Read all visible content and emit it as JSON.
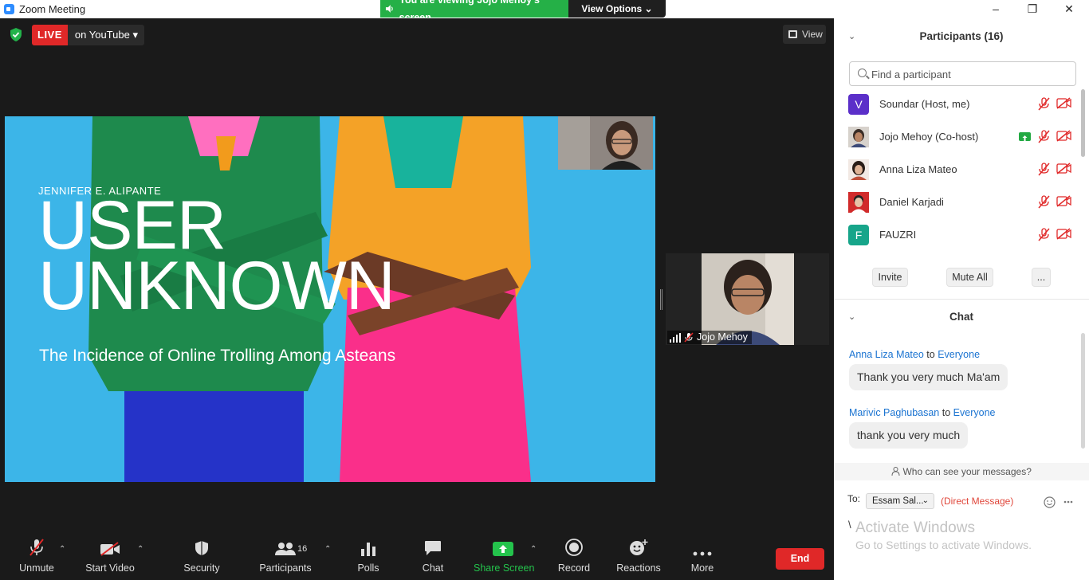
{
  "window": {
    "title": "Zoom Meeting",
    "minimize": "–",
    "restore": "❐",
    "close": "✕"
  },
  "banner": {
    "viewing_text": "You are viewing Jojo Mehoy's screen",
    "view_options": "View Options ⌄"
  },
  "live": {
    "badge": "LIVE",
    "destination": "on YouTube ▾"
  },
  "view_button": "View",
  "slide": {
    "author": "JENNIFER E. ALIPANTE",
    "title_line1": "USER",
    "title_line2": "UNKNOWN",
    "subtitle": "The Incidence of Online Trolling Among Asteans"
  },
  "video_tile": {
    "name": "Jojo Mehoy"
  },
  "toolbar": {
    "unmute": "Unmute",
    "start_video": "Start Video",
    "security": "Security",
    "participants": "Participants",
    "participants_count": "16",
    "polls": "Polls",
    "chat": "Chat",
    "share_screen": "Share Screen",
    "record": "Record",
    "reactions": "Reactions",
    "more": "More",
    "end": "End"
  },
  "colors": {
    "accent_green": "#25b047",
    "live_red": "#e02828",
    "link_blue": "#1a73d1",
    "avatar_purple": "#5b2fc9",
    "avatar_teal": "#17a58a"
  },
  "participants_panel": {
    "title": "Participants (16)",
    "search_placeholder": "Find a participant",
    "items": [
      {
        "name": "Soundar (Host, me)",
        "avatar_letter": "V",
        "avatar_color": "#5b2fc9"
      },
      {
        "name": "Jojo Mehoy (Co-host)",
        "avatar_letter": "",
        "avatar_color": "#7a6e66"
      },
      {
        "name": "Anna Liza Mateo",
        "avatar_letter": "",
        "avatar_color": "#c0503a"
      },
      {
        "name": "Daniel Karjadi",
        "avatar_letter": "",
        "avatar_color": "#d12b2b"
      },
      {
        "name": "FAUZRI",
        "avatar_letter": "F",
        "avatar_color": "#17a58a"
      }
    ],
    "invite": "Invite",
    "mute_all": "Mute All",
    "more": "..."
  },
  "chat_panel": {
    "title": "Chat",
    "messages": [
      {
        "from": "Anna Liza Mateo",
        "to_word": "to",
        "to": "Everyone",
        "text": "Thank you very much Ma'am"
      },
      {
        "from": "Marivic Paghubasan",
        "to_word": "to",
        "to": "Everyone",
        "text": "thank you very much"
      }
    ],
    "who_can_see": "Who can see your messages?",
    "to_label": "To:",
    "recipient": "Essam Sal...",
    "direct_message": "(Direct Message)",
    "input_value": "\\"
  },
  "watermark": {
    "line1": "Activate Windows",
    "line2": "Go to Settings to activate Windows."
  }
}
